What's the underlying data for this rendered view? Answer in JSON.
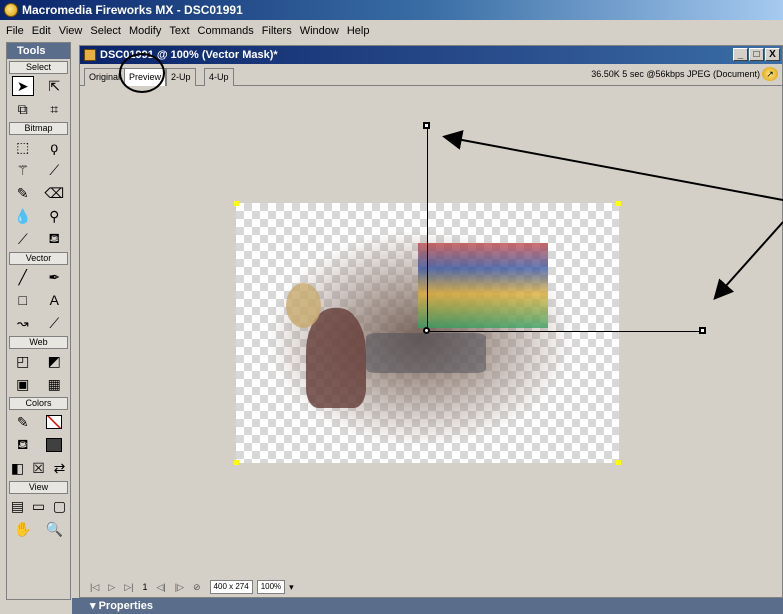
{
  "app": {
    "title": "Macromedia Fireworks MX - DSC01991"
  },
  "menu": [
    "File",
    "Edit",
    "View",
    "Select",
    "Modify",
    "Text",
    "Commands",
    "Filters",
    "Window",
    "Help"
  ],
  "tools": {
    "header": "Tools",
    "sections": {
      "select": "Select",
      "bitmap": "Bitmap",
      "vector": "Vector",
      "web": "Web",
      "colors": "Colors",
      "view": "View"
    }
  },
  "doc": {
    "title": "DSC01991 @ 100% (Vector Mask)*",
    "tabs": [
      "Original",
      "Preview",
      "2-Up",
      "4-Up"
    ],
    "active_tab": "Preview",
    "status": "36.50K 5 sec @56kbps JPEG (Document)",
    "window_buttons": [
      "_",
      "□",
      "X"
    ]
  },
  "playbar": {
    "frame": "1",
    "size": "400 x 274",
    "zoom": "100%"
  },
  "properties": {
    "label": "Properties"
  }
}
